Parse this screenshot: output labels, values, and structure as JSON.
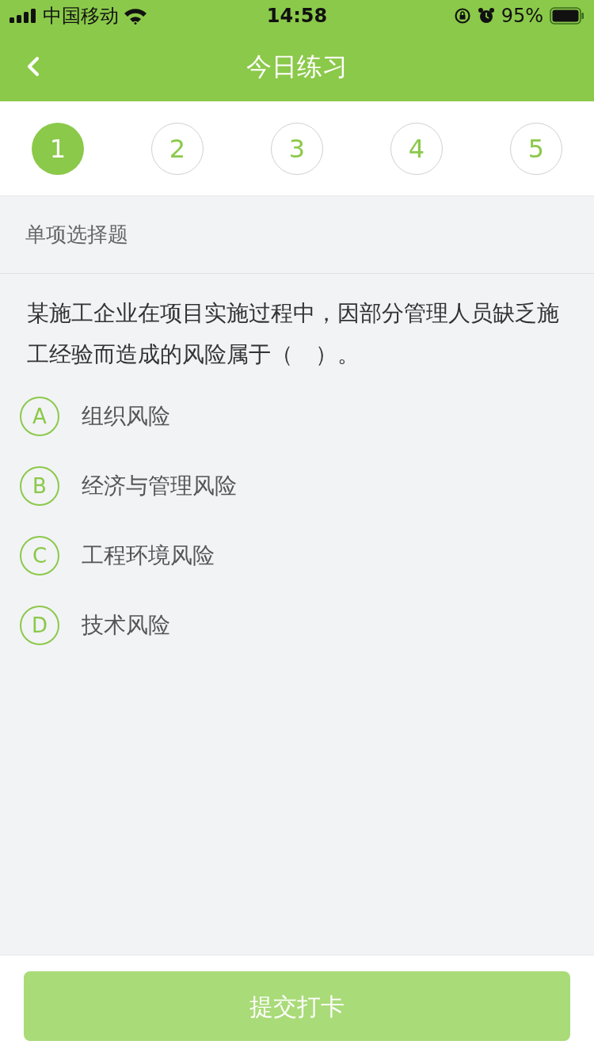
{
  "status_bar": {
    "carrier": "中国移动",
    "time": "14:58",
    "battery": "95%"
  },
  "nav": {
    "title": "今日练习"
  },
  "steps": [
    {
      "label": "1",
      "selected": true
    },
    {
      "label": "2",
      "selected": false
    },
    {
      "label": "3",
      "selected": false
    },
    {
      "label": "4",
      "selected": false
    },
    {
      "label": "5",
      "selected": false
    }
  ],
  "question": {
    "type_label": "单项选择题",
    "text": "某施工企业在项目实施过程中，因部分管理人员缺乏施工经验而造成的风险属于（　）。",
    "options": [
      {
        "letter": "A",
        "text": "组织风险",
        "selected": false
      },
      {
        "letter": "B",
        "text": "经济与管理风险",
        "selected": false
      },
      {
        "letter": "C",
        "text": "工程环境风险",
        "selected": false
      },
      {
        "letter": "D",
        "text": "技术风险",
        "selected": false
      }
    ]
  },
  "submit": {
    "label": "提交打卡",
    "disabled": true
  }
}
